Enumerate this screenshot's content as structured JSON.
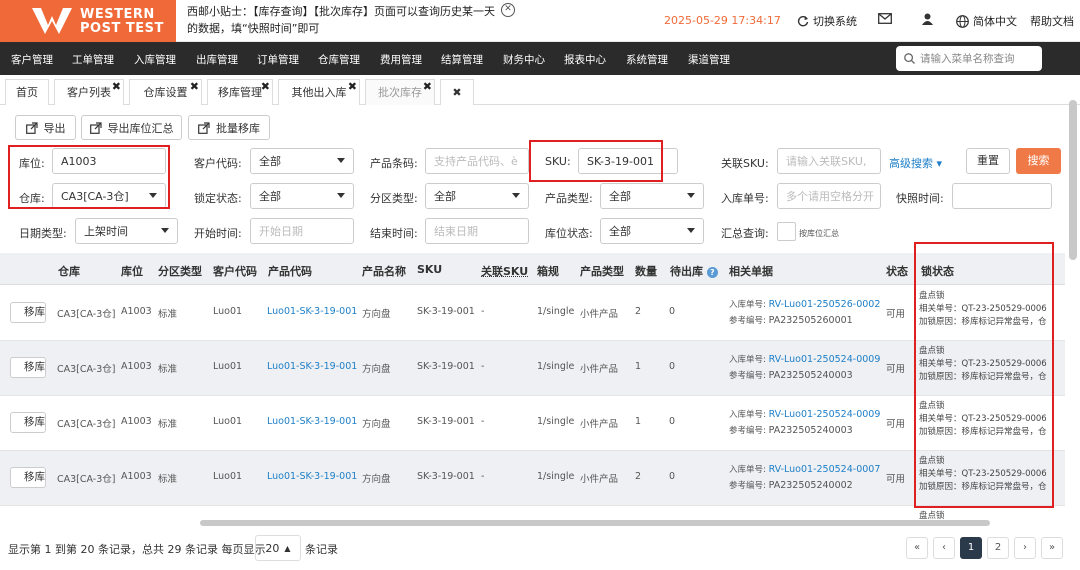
{
  "header": {
    "logo_line1": "WESTERN",
    "logo_line2": "POST TEST",
    "tip_text": "西邮小贴士：【库存查询】【批次库存】页面可以查询历史某一天的数据，填“快照时间”即可",
    "datetime": "2025-05-29 17:34:17",
    "switch_system": "切换系统",
    "language": "简体中文",
    "help": "帮助文档"
  },
  "nav": {
    "items": [
      "客户管理",
      "工单管理",
      "入库管理",
      "出库管理",
      "订单管理",
      "仓库管理",
      "费用管理",
      "结算管理",
      "财务中心",
      "报表中心",
      "系统管理",
      "渠道管理"
    ],
    "search_placeholder": "请输入菜单名称查询"
  },
  "tabs": [
    {
      "label": "首页"
    },
    {
      "label": "客户列表"
    },
    {
      "label": "仓库设置"
    },
    {
      "label": "移库管理"
    },
    {
      "label": "其他出入库"
    },
    {
      "label": "批次库存"
    }
  ],
  "toolbar": {
    "export": "导出",
    "export_summary": "导出库位汇总",
    "batch_move": "批量移库"
  },
  "filters": {
    "location_label": "库位:",
    "location_value": "A1003",
    "warehouse_label": "仓库:",
    "warehouse_value": "CA3[CA-3仓]",
    "customer_code_label": "客户代码:",
    "customer_code_value": "全部",
    "lock_status_label": "锁定状态:",
    "lock_status_value": "全部",
    "product_barcode_label": "产品条码:",
    "product_barcode_placeholder": "支持产品代码、è",
    "zone_type_label": "分区类型:",
    "zone_type_value": "全部",
    "sku_label": "SKU:",
    "sku_value": "SK-3-19-001",
    "product_type_label": "产品类型:",
    "product_type_value": "全部",
    "related_sku_label": "关联SKU:",
    "related_sku_placeholder": "请输入关联SKU,",
    "advanced_search": "高级搜索",
    "inbound_no_label": "入库单号:",
    "inbound_no_placeholder": "多个请用空格分开",
    "snapshot_label": "快照时间:",
    "date_type_label": "日期类型:",
    "date_type_value": "上架时间",
    "start_label": "开始时间:",
    "start_placeholder": "开始日期",
    "end_label": "结束时间:",
    "end_placeholder": "结束日期",
    "location_status_label": "库位状态:",
    "location_status_value": "全部",
    "summary_label": "汇总查询:",
    "summary_checkbox": "按库位汇总",
    "reset": "重置",
    "search": "搜索"
  },
  "table": {
    "columns": [
      "仓库",
      "库位",
      "分区类型",
      "客户代码",
      "产品代码",
      "产品名称",
      "SKU",
      "关联SKU",
      "箱规",
      "产品类型",
      "数量",
      "待出库",
      "相关单据",
      "状态",
      "锁状态"
    ],
    "row_button": "移库位",
    "rows": [
      {
        "warehouse": "CA3[CA-3仓]",
        "location": "A1003",
        "zone": "标准",
        "customer": "Luo01",
        "product_code": "Luo01-SK-3-19-001",
        "product_name": "方向盘",
        "sku": "SK-3-19-001",
        "related_sku": "-",
        "box": "1/single",
        "ptype": "小件产品",
        "qty": "2",
        "pending": "0",
        "doc_inbound_label": "入库单号:",
        "doc_inbound": "RV-Luo01-250526-0002",
        "doc_ref_label": "参考编号:",
        "doc_ref": "PA232505260001",
        "status": "可用",
        "lock_title": "盘点锁",
        "lock_related": "相关单号：QT-23-250529-0006",
        "lock_reason": "加锁原因：移库标记异常盘号，仓"
      },
      {
        "warehouse": "CA3[CA-3仓]",
        "location": "A1003",
        "zone": "标准",
        "customer": "Luo01",
        "product_code": "Luo01-SK-3-19-001",
        "product_name": "方向盘",
        "sku": "SK-3-19-001",
        "related_sku": "-",
        "box": "1/single",
        "ptype": "小件产品",
        "qty": "1",
        "pending": "0",
        "doc_inbound_label": "入库单号:",
        "doc_inbound": "RV-Luo01-250524-0009",
        "doc_ref_label": "参考编号:",
        "doc_ref": "PA232505240003",
        "status": "可用",
        "lock_title": "盘点锁",
        "lock_related": "相关单号：QT-23-250529-0006",
        "lock_reason": "加锁原因：移库标记异常盘号，仓"
      },
      {
        "warehouse": "CA3[CA-3仓]",
        "location": "A1003",
        "zone": "标准",
        "customer": "Luo01",
        "product_code": "Luo01-SK-3-19-001",
        "product_name": "方向盘",
        "sku": "SK-3-19-001",
        "related_sku": "-",
        "box": "1/single",
        "ptype": "小件产品",
        "qty": "1",
        "pending": "0",
        "doc_inbound_label": "入库单号:",
        "doc_inbound": "RV-Luo01-250524-0009",
        "doc_ref_label": "参考编号:",
        "doc_ref": "PA232505240003",
        "status": "可用",
        "lock_title": "盘点锁",
        "lock_related": "相关单号：QT-23-250529-0006",
        "lock_reason": "加锁原因：移库标记异常盘号，仓"
      },
      {
        "warehouse": "CA3[CA-3仓]",
        "location": "A1003",
        "zone": "标准",
        "customer": "Luo01",
        "product_code": "Luo01-SK-3-19-001",
        "product_name": "方向盘",
        "sku": "SK-3-19-001",
        "related_sku": "-",
        "box": "1/single",
        "ptype": "小件产品",
        "qty": "2",
        "pending": "0",
        "doc_inbound_label": "入库单号:",
        "doc_inbound": "RV-Luo01-250524-0007",
        "doc_ref_label": "参考编号:",
        "doc_ref": "PA232505240002",
        "status": "可用",
        "lock_title": "盘点锁",
        "lock_related": "相关单号：QT-23-250529-0006",
        "lock_reason": "加锁原因：移库标记异常盘号，仓"
      }
    ],
    "partial_lock_title": "盘点锁"
  },
  "footer": {
    "summary": "显示第 1 到第 20 条记录，总共 29 条记录 每页显示",
    "page_size": "20",
    "records_suffix": "条记录",
    "pages": [
      "1",
      "2"
    ],
    "first": "«",
    "prev": "‹",
    "next": "›",
    "last": "»"
  },
  "colors": {
    "brand": "#ef6a38",
    "nav_bg": "#2b2b2b",
    "link": "#1e7fc8",
    "highlight": "#e02020"
  }
}
